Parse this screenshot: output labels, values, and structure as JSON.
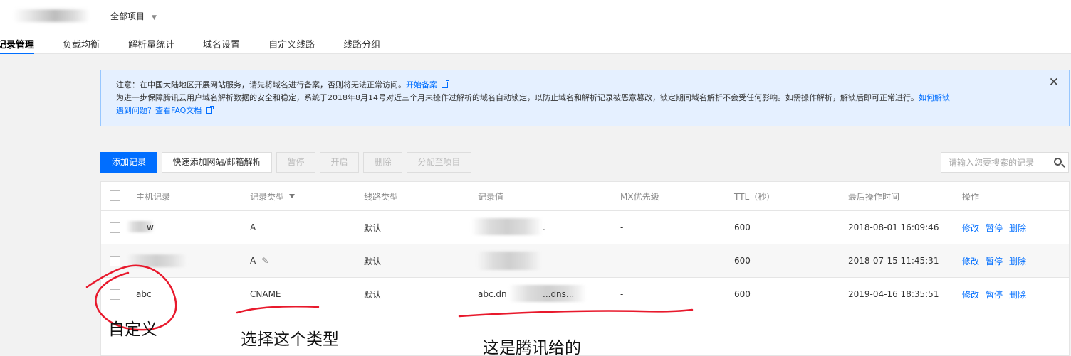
{
  "header": {
    "project_select": "全部项目"
  },
  "tabs": [
    "记录管理",
    "负载均衡",
    "解析量统计",
    "域名设置",
    "自定义线路",
    "线路分组"
  ],
  "notice": {
    "line1": "注意：在中国大陆地区开展网站服务，请先将域名进行备案，否则将无法正常访问。",
    "line1_link": "开始备案",
    "line2": "为进一步保障腾讯云用户域名解析数据的安全和稳定，系统于2018年8月14号对近三个月未操作过解析的域名自动锁定，以防止域名和解析记录被恶意篡改，锁定期间域名解析不会受任何影响。如需操作解析，解锁后即可正常进行。",
    "line2_link": "如何解锁",
    "line3": "遇到问题？查看FAQ文档"
  },
  "toolbar": {
    "add_record": "添加记录",
    "quick_add": "快速添加网站/邮箱解析",
    "pause": "暂停",
    "enable": "开启",
    "delete": "删除",
    "assign": "分配至项目"
  },
  "search": {
    "placeholder": "请输入您要搜索的记录"
  },
  "table": {
    "columns": [
      "主机记录",
      "记录类型",
      "线路类型",
      "记录值",
      "MX优先级",
      "TTL（秒）",
      "最后操作时间",
      "操作"
    ],
    "rows": [
      {
        "host": "w",
        "type": "A",
        "line": "默认",
        "value": ".",
        "mx": "-",
        "ttl": "600",
        "time": "2018-08-01 16:09:46"
      },
      {
        "host": "",
        "type": "A",
        "line": "默认",
        "value": "",
        "mx": "-",
        "ttl": "600",
        "time": "2018-07-15 11:45:31"
      },
      {
        "host": "abc",
        "type": "CNAME",
        "line": "默认",
        "value": "abc.dn",
        "value_tail": "...dns...",
        "mx": "-",
        "ttl": "600",
        "time": "2019-04-16 18:35:51"
      }
    ],
    "ops": [
      "修改",
      "暂停",
      "删除"
    ]
  },
  "annotations": {
    "custom": "自定义",
    "choose_type": "选择这个类型",
    "tencent_gives": "这是腾讯给的",
    "ink_color": "#e8192c"
  }
}
